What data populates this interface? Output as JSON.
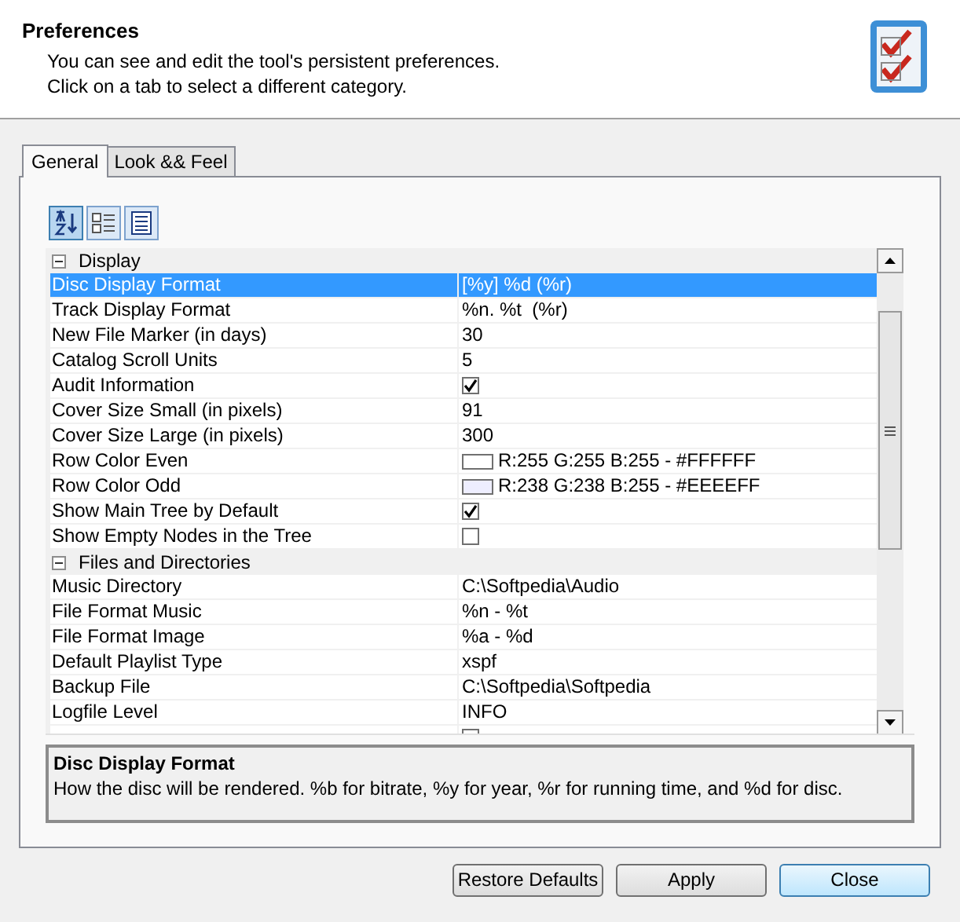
{
  "header": {
    "title": "Preferences",
    "lines": [
      "You can see and edit the tool's persistent preferences.",
      "Click on a tab to select a different category."
    ]
  },
  "tabs": [
    {
      "label": "General",
      "selected": true
    },
    {
      "label": "Look && Feel",
      "selected": false
    }
  ],
  "toolbar": [
    {
      "kind": "sort",
      "selected": true
    },
    {
      "kind": "categorized",
      "selected": false
    },
    {
      "kind": "pages",
      "selected": false
    }
  ],
  "grid": {
    "categories": [
      {
        "name": "Display",
        "expanded": true,
        "rows": [
          {
            "name": "Disc Display Format",
            "kind": "text",
            "value": "[%y] %d (%r)",
            "selected": true
          },
          {
            "name": "Track Display Format",
            "kind": "text",
            "value": "%n. %t  (%r)",
            "selected": false
          },
          {
            "name": "New File Marker (in days)",
            "kind": "text",
            "value": "30",
            "selected": false
          },
          {
            "name": "Catalog Scroll Units",
            "kind": "text",
            "value": "5",
            "selected": false
          },
          {
            "name": "Audit Information",
            "kind": "checkbox",
            "checked": true,
            "selected": false
          },
          {
            "name": "Cover Size Small (in pixels)",
            "kind": "text",
            "value": "91",
            "selected": false
          },
          {
            "name": "Cover Size Large (in pixels)",
            "kind": "text",
            "value": "300",
            "selected": false
          },
          {
            "name": "Row Color Even",
            "kind": "color",
            "color": "#ffffff",
            "value": "R:255 G:255 B:255 - #FFFFFF",
            "selected": false
          },
          {
            "name": "Row Color Odd",
            "kind": "color",
            "color": "#eeeeff",
            "value": "R:238 G:238 B:255 - #EEEEFF",
            "selected": false
          },
          {
            "name": "Show Main Tree by Default",
            "kind": "checkbox",
            "checked": true,
            "selected": false
          },
          {
            "name": "Show Empty Nodes in the Tree",
            "kind": "checkbox",
            "checked": false,
            "selected": false
          }
        ]
      },
      {
        "name": "Files and Directories",
        "expanded": true,
        "rows": [
          {
            "name": "Music Directory",
            "kind": "text",
            "value": "C:\\Softpedia\\Audio",
            "selected": false
          },
          {
            "name": "File Format Music",
            "kind": "text",
            "value": "%n - %t",
            "selected": false
          },
          {
            "name": "File Format Image",
            "kind": "text",
            "value": "%a - %d",
            "selected": false
          },
          {
            "name": "Default Playlist Type",
            "kind": "text",
            "value": "xspf",
            "selected": false
          },
          {
            "name": "Backup File",
            "kind": "text",
            "value": "C:\\Softpedia\\Softpedia",
            "selected": false
          },
          {
            "name": "Logfile Level",
            "kind": "text",
            "value": "INFO",
            "selected": false
          },
          {
            "kind": "checkbox",
            "checked": false,
            "selected": false
          }
        ]
      }
    ]
  },
  "description": {
    "title": "Disc Display Format",
    "text": "How the disc will be rendered. %b for bitrate, %y for year, %r for running time, and %d for disc."
  },
  "buttons": [
    {
      "label": "Restore Defaults",
      "default": false
    },
    {
      "label": "Apply",
      "default": false
    },
    {
      "label": "Close",
      "default": true
    }
  ]
}
